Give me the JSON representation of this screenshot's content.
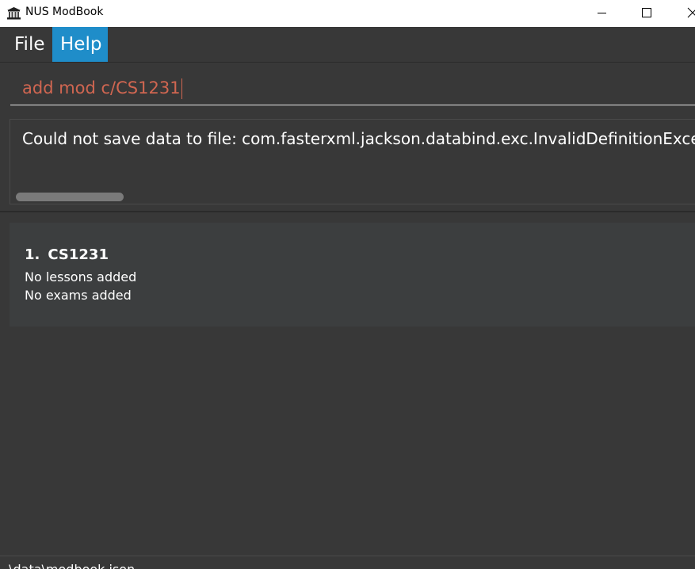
{
  "window": {
    "title": "NUS ModBook",
    "app_icon": "bank-building-icon",
    "controls": [
      "minimize-icon",
      "maximize-icon",
      "close-icon"
    ]
  },
  "menu": {
    "items": [
      {
        "label": "File"
      },
      {
        "label": "Help",
        "active": true
      }
    ]
  },
  "command": {
    "value": "add mod c/CS1231",
    "text_color": "#d06651"
  },
  "result": {
    "message": "Could not save data to file: com.fasterxml.jackson.databind.exc.InvalidDefinitionExceptio"
  },
  "modules": [
    {
      "index": "1.",
      "code": "CS1231",
      "lessons": "No lessons added",
      "exams": "No exams added"
    }
  ],
  "status_bar": {
    "path": ".\\data\\modbook.json"
  },
  "colors": {
    "background": "#383838",
    "accent": "#1f8dc9",
    "card": "#3c3e3f"
  }
}
